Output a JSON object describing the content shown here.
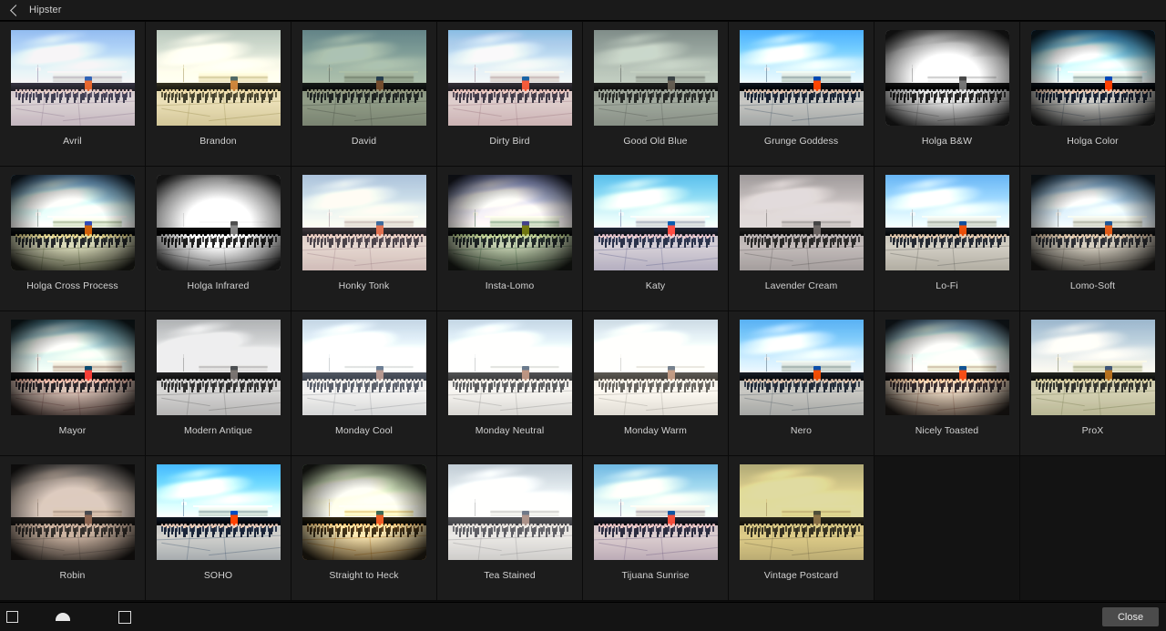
{
  "header": {
    "title": "Hipster",
    "back_icon": "back-chevron-icon"
  },
  "grid": {
    "columns": 8,
    "rows": 4,
    "filters": [
      {
        "name": "Avril",
        "tint": "rgba(196,150,210,0.38)",
        "blend": "overlay",
        "sat": 1.05,
        "bright": 1.12,
        "contrast": 0.92,
        "hue": 0,
        "sepia": 0,
        "gray": 0,
        "vignette": false,
        "frame": false
      },
      {
        "name": "Brandon",
        "tint": "rgba(214,196,92,0.42)",
        "blend": "overlay",
        "sat": 0.85,
        "bright": 1.05,
        "contrast": 1.0,
        "hue": 0,
        "sepia": 0.35,
        "gray": 0,
        "vignette": false,
        "frame": false
      },
      {
        "name": "David",
        "tint": "rgba(70,120,96,0.45)",
        "blend": "multiply",
        "sat": 0.7,
        "bright": 1.0,
        "contrast": 1.05,
        "hue": 0,
        "sepia": 0.25,
        "gray": 0,
        "vignette": false,
        "frame": false
      },
      {
        "name": "Dirty Bird",
        "tint": "rgba(230,150,180,0.40)",
        "blend": "overlay",
        "sat": 1.1,
        "bright": 1.08,
        "contrast": 0.95,
        "hue": -10,
        "sepia": 0,
        "gray": 0,
        "vignette": false,
        "frame": false
      },
      {
        "name": "Good Old Blue",
        "tint": "rgba(150,178,160,0.50)",
        "blend": "multiply",
        "sat": 0.35,
        "bright": 1.0,
        "contrast": 1.0,
        "hue": 0,
        "sepia": 0.2,
        "gray": 0.55,
        "vignette": false,
        "frame": false
      },
      {
        "name": "Grunge Goddess",
        "tint": "rgba(40,110,200,0.18)",
        "blend": "overlay",
        "sat": 1.35,
        "bright": 1.0,
        "contrast": 1.15,
        "hue": 0,
        "sepia": 0,
        "gray": 0,
        "vignette": false,
        "frame": false
      },
      {
        "name": "Holga B&W",
        "tint": "rgba(0,0,0,0)",
        "blend": "normal",
        "sat": 0,
        "bright": 1.12,
        "contrast": 1.2,
        "hue": 0,
        "sepia": 0,
        "gray": 1,
        "vignette": true,
        "frame": true
      },
      {
        "name": "Holga Color",
        "tint": "rgba(20,90,190,0.18)",
        "blend": "overlay",
        "sat": 1.4,
        "bright": 1.02,
        "contrast": 1.2,
        "hue": 0,
        "sepia": 0,
        "gray": 0,
        "vignette": true,
        "frame": true
      },
      {
        "name": "Holga Cross Process",
        "tint": "rgba(120,170,40,0.22)",
        "blend": "overlay",
        "sat": 1.5,
        "bright": 1.05,
        "contrast": 1.15,
        "hue": 18,
        "sepia": 0.1,
        "gray": 0,
        "vignette": true,
        "frame": true
      },
      {
        "name": "Holga Infrared",
        "tint": "rgba(0,0,0,0)",
        "blend": "normal",
        "sat": 0,
        "bright": 1.25,
        "contrast": 1.35,
        "hue": 0,
        "sepia": 0,
        "gray": 1,
        "vignette": true,
        "frame": true
      },
      {
        "name": "Honky Tonk",
        "tint": "rgba(225,165,190,0.42)",
        "blend": "overlay",
        "sat": 0.95,
        "bright": 1.1,
        "contrast": 0.92,
        "hue": -8,
        "sepia": 0.15,
        "gray": 0,
        "vignette": false,
        "frame": false
      },
      {
        "name": "Insta-Lomo",
        "tint": "rgba(60,150,90,0.40)",
        "blend": "overlay",
        "sat": 1.2,
        "bright": 1.0,
        "contrast": 1.1,
        "hue": 40,
        "sepia": 0.2,
        "gray": 0,
        "vignette": true,
        "frame": false
      },
      {
        "name": "Katy",
        "tint": "rgba(105,115,225,0.34)",
        "blend": "overlay",
        "sat": 1.15,
        "bright": 1.1,
        "contrast": 1.0,
        "hue": -14,
        "sepia": 0,
        "gray": 0,
        "vignette": false,
        "frame": false
      },
      {
        "name": "Lavender Cream",
        "tint": "rgba(190,176,180,0.45)",
        "blend": "multiply",
        "sat": 0.15,
        "bright": 1.05,
        "contrast": 1.05,
        "hue": 0,
        "sepia": 0.3,
        "gray": 0.8,
        "vignette": false,
        "frame": false
      },
      {
        "name": "Lo-Fi",
        "tint": "rgba(0,0,0,0)",
        "blend": "normal",
        "sat": 1.15,
        "bright": 1.04,
        "contrast": 1.1,
        "hue": 0,
        "sepia": 0,
        "gray": 0,
        "vignette": false,
        "frame": false
      },
      {
        "name": "Lomo-Soft",
        "tint": "rgba(240,200,150,0.12)",
        "blend": "overlay",
        "sat": 1.1,
        "bright": 1.04,
        "contrast": 1.05,
        "hue": 0,
        "sepia": 0.05,
        "gray": 0,
        "vignette": true,
        "frame": false
      },
      {
        "name": "Mayor",
        "tint": "rgba(185,70,80,0.32)",
        "blend": "overlay",
        "sat": 1.2,
        "bright": 1.02,
        "contrast": 1.1,
        "hue": -20,
        "sepia": 0.1,
        "gray": 0,
        "vignette": true,
        "frame": false
      },
      {
        "name": "Modern Antique",
        "tint": "rgba(205,205,210,0.35)",
        "blend": "multiply",
        "sat": 0.2,
        "bright": 1.15,
        "contrast": 1.05,
        "hue": 0,
        "sepia": 0.1,
        "gray": 0.75,
        "vignette": false,
        "frame": false
      },
      {
        "name": "Monday Cool",
        "tint": "rgba(180,200,235,0.30)",
        "blend": "screen",
        "sat": 0.45,
        "bright": 1.2,
        "contrast": 1.1,
        "hue": 0,
        "sepia": 0,
        "gray": 0.4,
        "vignette": false,
        "frame": false
      },
      {
        "name": "Monday Neutral",
        "tint": "rgba(215,215,215,0.25)",
        "blend": "screen",
        "sat": 0.5,
        "bright": 1.2,
        "contrast": 1.1,
        "hue": 0,
        "sepia": 0.05,
        "gray": 0.35,
        "vignette": false,
        "frame": false
      },
      {
        "name": "Monday Warm",
        "tint": "rgba(235,220,195,0.28)",
        "blend": "screen",
        "sat": 0.5,
        "bright": 1.2,
        "contrast": 1.1,
        "hue": 0,
        "sepia": 0.15,
        "gray": 0.3,
        "vignette": false,
        "frame": false
      },
      {
        "name": "Nero",
        "tint": "rgba(60,120,200,0.14)",
        "blend": "overlay",
        "sat": 1.25,
        "bright": 1.02,
        "contrast": 1.08,
        "hue": 0,
        "sepia": 0,
        "gray": 0,
        "vignette": false,
        "frame": false
      },
      {
        "name": "Nicely Toasted",
        "tint": "rgba(205,90,60,0.35)",
        "blend": "overlay",
        "sat": 1.3,
        "bright": 1.12,
        "contrast": 1.05,
        "hue": -6,
        "sepia": 0.1,
        "gray": 0,
        "vignette": true,
        "frame": false
      },
      {
        "name": "ProX",
        "tint": "rgba(170,185,95,0.30)",
        "blend": "overlay",
        "sat": 0.9,
        "bright": 1.0,
        "contrast": 1.05,
        "hue": 12,
        "sepia": 0.2,
        "gray": 0,
        "vignette": false,
        "frame": false
      },
      {
        "name": "Robin",
        "tint": "rgba(175,130,120,0.42)",
        "blend": "multiply",
        "sat": 0.55,
        "bright": 1.12,
        "contrast": 0.95,
        "hue": 0,
        "sepia": 0.4,
        "gray": 0.3,
        "vignette": true,
        "frame": false
      },
      {
        "name": "SOHO",
        "tint": "rgba(20,100,210,0.22)",
        "blend": "overlay",
        "sat": 1.45,
        "bright": 1.05,
        "contrast": 1.15,
        "hue": 0,
        "sepia": 0,
        "gray": 0,
        "vignette": false,
        "frame": false
      },
      {
        "name": "Straight to Heck",
        "tint": "rgba(245,140,20,0.58)",
        "blend": "overlay",
        "sat": 1.6,
        "bright": 1.1,
        "contrast": 1.1,
        "hue": -18,
        "sepia": 0.35,
        "gray": 0,
        "vignette": true,
        "frame": true
      },
      {
        "name": "Tea Stained",
        "tint": "rgba(200,200,215,0.30)",
        "blend": "screen",
        "sat": 0.45,
        "bright": 1.12,
        "contrast": 1.08,
        "hue": 0,
        "sepia": 0.1,
        "gray": 0.45,
        "vignette": false,
        "frame": false
      },
      {
        "name": "Tijuana Sunrise",
        "tint": "rgba(150,110,215,0.32)",
        "blend": "overlay",
        "sat": 1.2,
        "bright": 1.05,
        "contrast": 1.05,
        "hue": -12,
        "sepia": 0.12,
        "gray": 0,
        "vignette": false,
        "frame": false
      },
      {
        "name": "Vintage Postcard",
        "tint": "rgba(190,180,70,0.48)",
        "blend": "multiply",
        "sat": 0.4,
        "bright": 1.1,
        "contrast": 1.0,
        "hue": 0,
        "sepia": 0.6,
        "gray": 0.2,
        "vignette": false,
        "frame": false
      }
    ]
  },
  "navbar": {
    "back_icon": "nav-back-square-icon",
    "home_icon": "nav-home-dome-icon",
    "recents_icon": "nav-recents-square-icon",
    "close_label": "Close"
  },
  "colors": {
    "page_background": "#0d0d0d",
    "cell_background": "#1c1c1c",
    "header_background": "#1a1a1a",
    "label_text": "#d2d2d2",
    "close_button": "#4b4b4b"
  }
}
